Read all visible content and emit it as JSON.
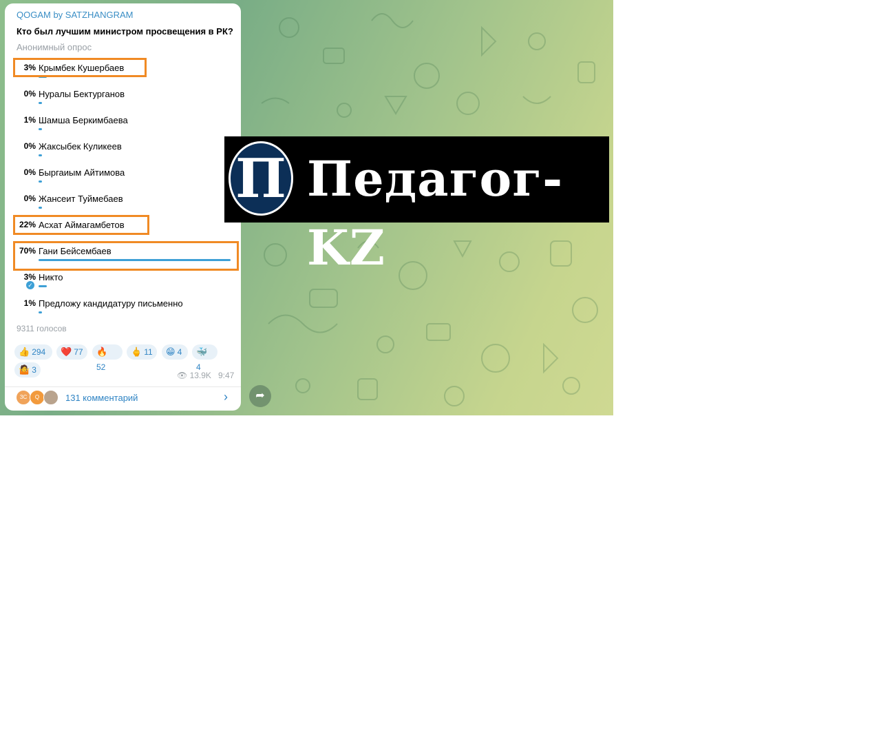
{
  "post": {
    "channel": "QOGAM by SATZHANGRAM",
    "question": "Кто был лучшим министром просвещения в РК?",
    "poll_type": "Анонимный опрос",
    "options": [
      {
        "pct": "3%",
        "label": "Крымбек Кушербаев",
        "value": 3
      },
      {
        "pct": "0%",
        "label": "Нуралы Бектурганов",
        "value": 0
      },
      {
        "pct": "1%",
        "label": "Шамша Беркимбаева",
        "value": 1
      },
      {
        "pct": "0%",
        "label": "Жаксыбек Куликеев",
        "value": 0
      },
      {
        "pct": "0%",
        "label": "Быргаиым Айтимова",
        "value": 0
      },
      {
        "pct": "0%",
        "label": "Жансеит Туймебаев",
        "value": 0
      },
      {
        "pct": "22%",
        "label": "Асхат Аймагамбетов",
        "value": 22
      },
      {
        "pct": "70%",
        "label": "Гани Бейсембаев",
        "value": 70
      },
      {
        "pct": "3%",
        "label": "Никто",
        "value": 3,
        "voted": true
      },
      {
        "pct": "1%",
        "label": "Предложу кандидатуру письменно",
        "value": 1
      }
    ],
    "votes": "9311 голосов",
    "reactions": [
      {
        "emoji": "👍",
        "count": "294"
      },
      {
        "emoji": "❤️",
        "count": "77"
      },
      {
        "emoji": "🔥",
        "count": "52"
      },
      {
        "emoji": "🖕",
        "count": "11"
      },
      {
        "emoji": "😁",
        "count": "4"
      },
      {
        "emoji": "🐳",
        "count": "4"
      },
      {
        "emoji": "🤷",
        "count": "3"
      }
    ],
    "views": "13.9K",
    "time": "9:47",
    "comments_label": "131 комментарий",
    "avatars": [
      {
        "initials": "ЗС",
        "color": "#f0a35a"
      },
      {
        "initials": "Q",
        "color": "#f29a3c"
      },
      {
        "initials": "",
        "color": "#b9a38d"
      }
    ]
  },
  "logo": {
    "letter": "П",
    "text": "Педагог-KZ"
  },
  "colors": {
    "accent": "#3ea0d6",
    "highlight": "#f08a24"
  }
}
